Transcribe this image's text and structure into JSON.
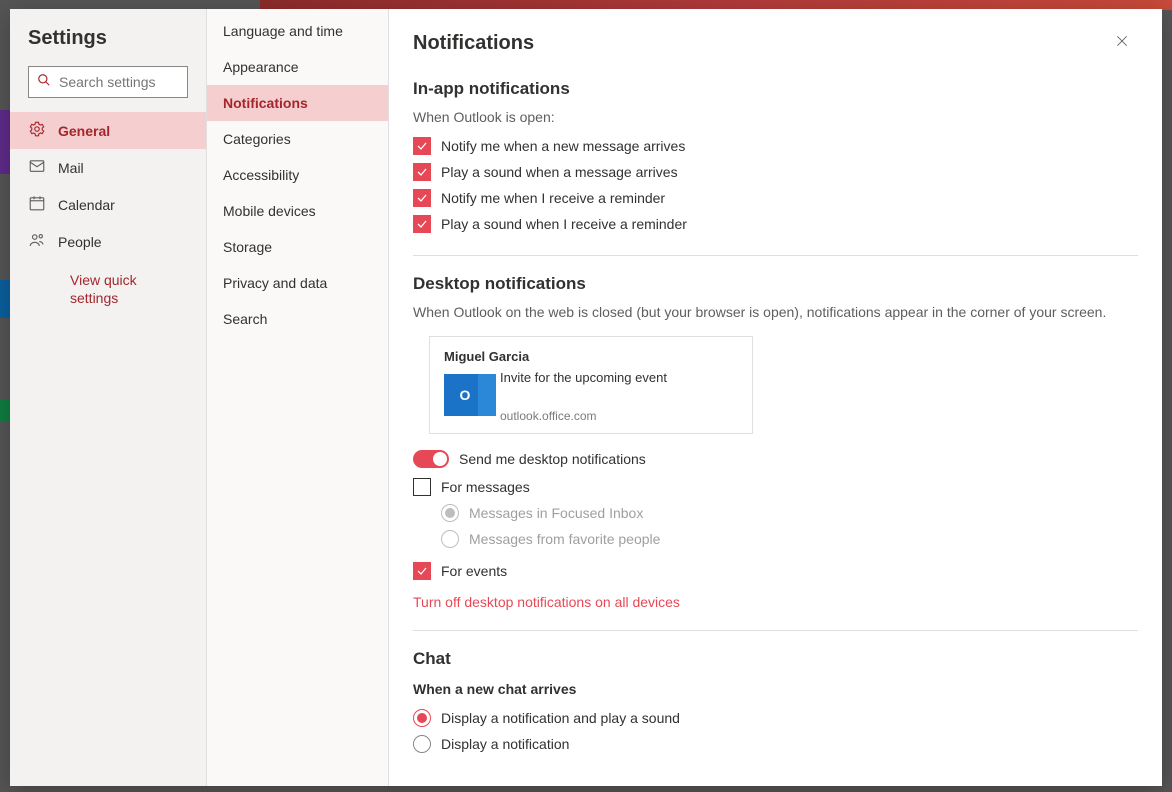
{
  "header": {
    "title": "Settings",
    "search_placeholder": "Search settings"
  },
  "categories": [
    {
      "id": "general",
      "label": "General",
      "icon": "gear"
    },
    {
      "id": "mail",
      "label": "Mail",
      "icon": "mail"
    },
    {
      "id": "calendar",
      "label": "Calendar",
      "icon": "calendar"
    },
    {
      "id": "people",
      "label": "People",
      "icon": "people"
    }
  ],
  "selected_category": "general",
  "quick_settings_link": "View quick settings",
  "subcategories": [
    "Language and time",
    "Appearance",
    "Notifications",
    "Categories",
    "Accessibility",
    "Mobile devices",
    "Storage",
    "Privacy and data",
    "Search"
  ],
  "selected_subcategory": "Notifications",
  "main": {
    "title": "Notifications",
    "inapp": {
      "heading": "In-app notifications",
      "subheading": "When Outlook is open:",
      "options": [
        {
          "label": "Notify me when a new message arrives",
          "checked": true
        },
        {
          "label": "Play a sound when a message arrives",
          "checked": true
        },
        {
          "label": "Notify me when I receive a reminder",
          "checked": true
        },
        {
          "label": "Play a sound when I receive a reminder",
          "checked": true
        }
      ]
    },
    "desktop": {
      "heading": "Desktop notifications",
      "description": "When Outlook on the web is closed (but your browser is open), notifications appear in the corner of your screen.",
      "preview": {
        "sender": "Miguel Garcia",
        "subject": "Invite for the upcoming event",
        "source": "outlook.office.com"
      },
      "toggle_label": "Send me desktop notifications",
      "toggle_on": true,
      "for_messages": {
        "label": "For messages",
        "checked": false
      },
      "msg_options": [
        {
          "label": "Messages in Focused Inbox",
          "selected": true
        },
        {
          "label": "Messages from favorite people",
          "selected": false
        }
      ],
      "for_events": {
        "label": "For events",
        "checked": true
      },
      "turn_off_link": "Turn off desktop notifications on all devices"
    },
    "chat": {
      "heading": "Chat",
      "subheading": "When a new chat arrives",
      "options": [
        {
          "label": "Display a notification and play a sound",
          "selected": true
        },
        {
          "label": "Display a notification",
          "selected": false
        }
      ]
    }
  }
}
